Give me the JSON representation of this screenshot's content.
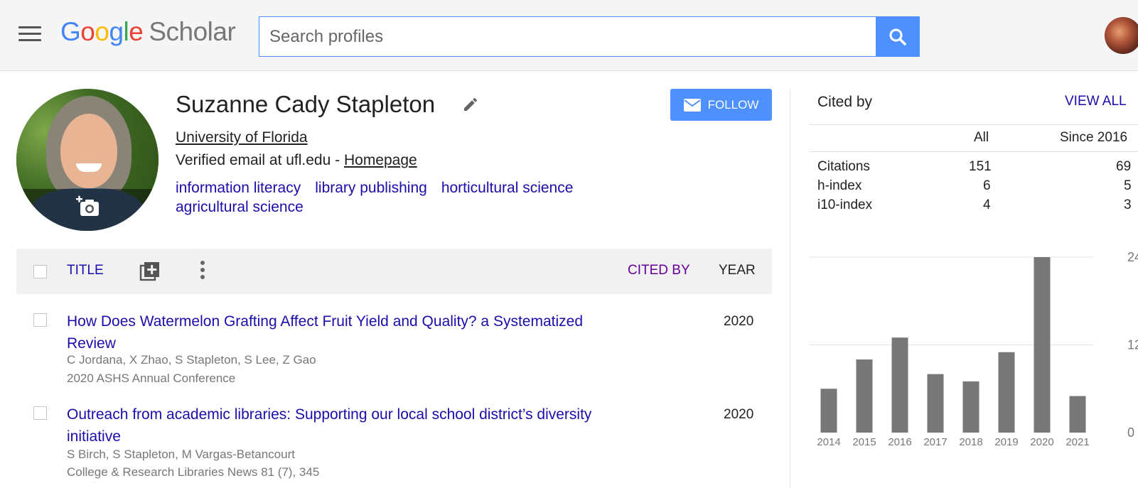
{
  "app": {
    "logo_google": "Google",
    "logo_scholar": "Scholar",
    "search_placeholder": "Search profiles"
  },
  "profile": {
    "name": "Suzanne Cady Stapleton",
    "affiliation": "University of Florida",
    "email_text": "Verified email at ufl.edu - ",
    "homepage": "Homepage",
    "interests": [
      "information literacy",
      "library publishing",
      "horticultural science",
      "agricultural science"
    ],
    "follow_label": "FOLLOW"
  },
  "table": {
    "title_label": "TITLE",
    "cited_by_label": "CITED BY",
    "year_label": "YEAR",
    "articles": [
      {
        "title": "How Does Watermelon Grafting Affect Fruit Yield and Quality? a Systematized Review",
        "authors": "C Jordana, X Zhao, S Stapleton, S Lee, Z Gao",
        "venue": "2020 ASHS Annual Conference",
        "year": "2020"
      },
      {
        "title": "Outreach from academic libraries: Supporting our local school district’s diversity initiative",
        "authors": "S Birch, S Stapleton, M Vargas-Betancourt",
        "venue": "College & Research Libraries News 81 (7), 345",
        "year": "2020"
      }
    ]
  },
  "cited_by": {
    "title": "Cited by",
    "view_all": "VIEW ALL",
    "col_all": "All",
    "col_since": "Since 2016",
    "rows": [
      {
        "label": "Citations",
        "all": "151",
        "since": "69"
      },
      {
        "label": "h-index",
        "all": "6",
        "since": "5"
      },
      {
        "label": "i10-index",
        "all": "4",
        "since": "3"
      }
    ]
  },
  "chart_data": {
    "type": "bar",
    "categories": [
      "2014",
      "2015",
      "2016",
      "2017",
      "2018",
      "2019",
      "2020",
      "2021"
    ],
    "values": [
      6,
      10,
      13,
      8,
      7,
      11,
      24,
      5
    ],
    "ylim": [
      0,
      24
    ],
    "yticks": [
      "24",
      "12",
      "0"
    ],
    "grid": true,
    "bar_color": "#777777"
  },
  "colors": {
    "accent": "#4d90fe",
    "link": "#1a0dab",
    "visited": "#660099"
  }
}
